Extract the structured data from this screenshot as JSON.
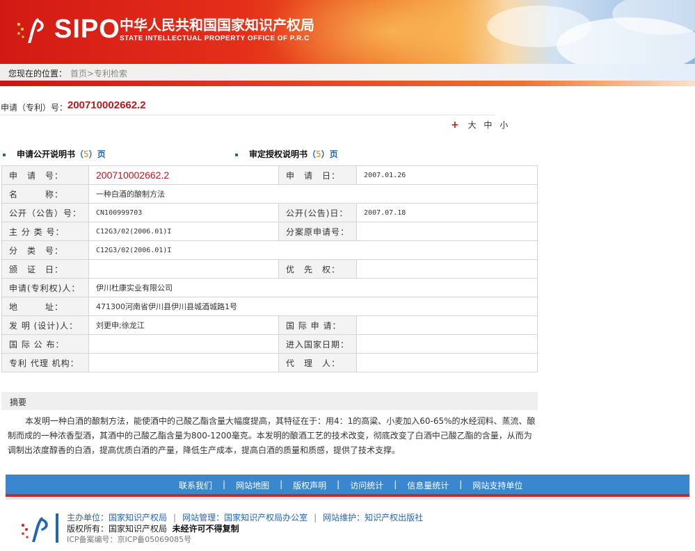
{
  "header": {
    "logo_text": "SIPO",
    "cn_title": "中华人民共和国国家知识产权局",
    "en_title": "STATE INTELLECTUAL PROPERTY OFFICE OF P.R.C"
  },
  "breadcrumb": {
    "label": "您现在的位置：",
    "path": "首页>专利检索"
  },
  "application": {
    "label": "申请（专利）号：",
    "number": "200710002662.2"
  },
  "font_size": {
    "plus": "+",
    "large": "大",
    "medium": "中",
    "small": "小"
  },
  "doc_links": {
    "publication": {
      "label": "申请公开说明书",
      "open": "（",
      "count": "5",
      "close": "）",
      "page": "页"
    },
    "grant": {
      "label": "审定授权说明书",
      "open": "（",
      "count": "5",
      "close": "）",
      "page": "页"
    }
  },
  "table": {
    "app_no_label": "申　请　号：",
    "app_no": "200710002662.2",
    "app_date_label": "申　请　日：",
    "app_date": "2007.01.26",
    "name_label": "名　　　称：",
    "name": "一种白酒的酿制方法",
    "pub_no_label": "公开（公告）号：",
    "pub_no": "CN100999703",
    "pub_date_label": "公开(公告)日：",
    "pub_date": "2007.07.18",
    "main_class_label": "主 分 类 号：",
    "main_class": "C12G3/02(2006.01)I",
    "div_label": "分案原申请号：",
    "div": "",
    "class_label": "分　类　号：",
    "class": "C12G3/02(2006.01)I",
    "cert_date_label": "颁　证　日：",
    "cert_date": "",
    "priority_label": "优　先　权：",
    "priority": "",
    "applicant_label": "申请(专利权)人：",
    "applicant": "伊川杜康实业有限公司",
    "address_label": "地　　　址：",
    "address": "471300河南省伊川县伊川县城酒城路1号",
    "inventor_label": "发 明 (设计)人：",
    "inventor": "刘更申;徐龙江",
    "intl_app_label": "国 际 申 请：",
    "intl_app": "",
    "intl_pub_label": "国 际 公 布：",
    "intl_pub": "",
    "nat_entry_label": "进入国家日期：",
    "nat_entry": "",
    "agency_label": "专利 代理 机构：",
    "agency": "",
    "agent_label": "代　理　人：",
    "agent": ""
  },
  "abstract": {
    "heading": "摘要",
    "text": "本发明一种白酒的酿制方法，能使酒中的己酸乙酯含量大幅度提高，其特征在于：用4：1的高粱、小麦加入60-65%的水经润料、蒸流、酿制而成的一种浓香型酒，其酒中的己酸乙酯含量为800-1200毫克。本发明的酿酒工艺的技术改变，彻底改变了白酒中己酸乙酯的含量，从而为调制出浓度醇香的白酒，提高优质白酒的产量，降低生产成本，提高白酒的质量和质感，提供了技术支撑。"
  },
  "footer": {
    "nav": [
      "联系我们",
      "网站地图",
      "版权声明",
      "访问统计",
      "信息量统计",
      "网站支持单位"
    ],
    "nav_sep": "|",
    "host": "主办单位：国家知识产权局",
    "admin": "网站管理：国家知识产权局办公室",
    "maint": "网站维护：知识产权出版社",
    "sep": "|",
    "copyright_a": "版权所有：国家知识产权局",
    "copyright_b": "未经许可不得复制",
    "icp": "ICP备案编号：京ICP备05069085号"
  },
  "colors": {
    "accent_red": "#b5191c",
    "link_blue": "#2366b0",
    "nav_blue": "#3a86cf"
  }
}
